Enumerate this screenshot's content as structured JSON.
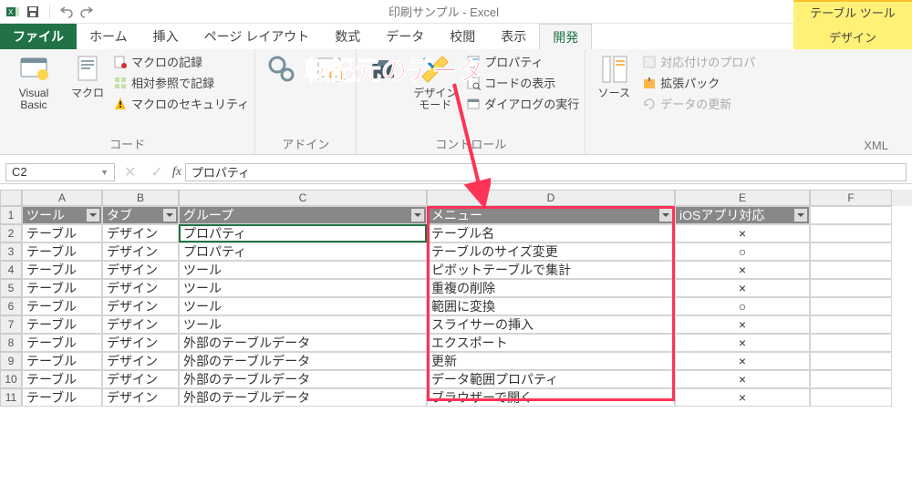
{
  "titlebar": {
    "title": "印刷サンプル - Excel"
  },
  "tabletools": {
    "header": "テーブル ツール",
    "tab": "デザイン"
  },
  "tabs": {
    "file": "ファイル",
    "home": "ホーム",
    "insert": "挿入",
    "page": "ページ レイアウト",
    "formula": "数式",
    "data": "データ",
    "review": "校閲",
    "view": "表示",
    "dev": "開発"
  },
  "ribbon": {
    "code": {
      "label": "コード",
      "vb": "Visual Basic",
      "macro": "マクロ",
      "record": "マクロの記録",
      "relref": "相対参照で記録",
      "security": "マクロのセキュリティ"
    },
    "addin": {
      "label": "アドイン"
    },
    "control": {
      "label": "コントロール",
      "designmode": "デザイン\nモード",
      "prop": "プロパティ",
      "code": "コードの表示",
      "dialog": "ダイアログの実行"
    },
    "xml": {
      "label": "XML",
      "source": "ソース",
      "mapprop": "対応付けのプロパ",
      "pack": "拡張パック",
      "refresh": "データの更新"
    }
  },
  "formula": {
    "namebox": "C2",
    "value": "プロパティ"
  },
  "annotation": {
    "text": "転記元のデータ"
  },
  "table": {
    "headers": [
      "ツール",
      "タブ",
      "グループ",
      "メニュー",
      "iOSアプリ対応"
    ],
    "rows": [
      [
        "テーブル",
        "デザイン",
        "プロパティ",
        "テーブル名",
        "×"
      ],
      [
        "テーブル",
        "デザイン",
        "プロパティ",
        "テーブルのサイズ変更",
        "○"
      ],
      [
        "テーブル",
        "デザイン",
        "ツール",
        "ピボットテーブルで集計",
        "×"
      ],
      [
        "テーブル",
        "デザイン",
        "ツール",
        "重複の削除",
        "×"
      ],
      [
        "テーブル",
        "デザイン",
        "ツール",
        "範囲に変換",
        "○"
      ],
      [
        "テーブル",
        "デザイン",
        "ツール",
        "スライサーの挿入",
        "×"
      ],
      [
        "テーブル",
        "デザイン",
        "外部のテーブルデータ",
        "エクスポート",
        "×"
      ],
      [
        "テーブル",
        "デザイン",
        "外部のテーブルデータ",
        "更新",
        "×"
      ],
      [
        "テーブル",
        "デザイン",
        "外部のテーブルデータ",
        "データ範囲プロパティ",
        "×"
      ],
      [
        "テーブル",
        "デザイン",
        "外部のテーブルデータ",
        "ブラウザーで開く",
        "×"
      ]
    ]
  }
}
